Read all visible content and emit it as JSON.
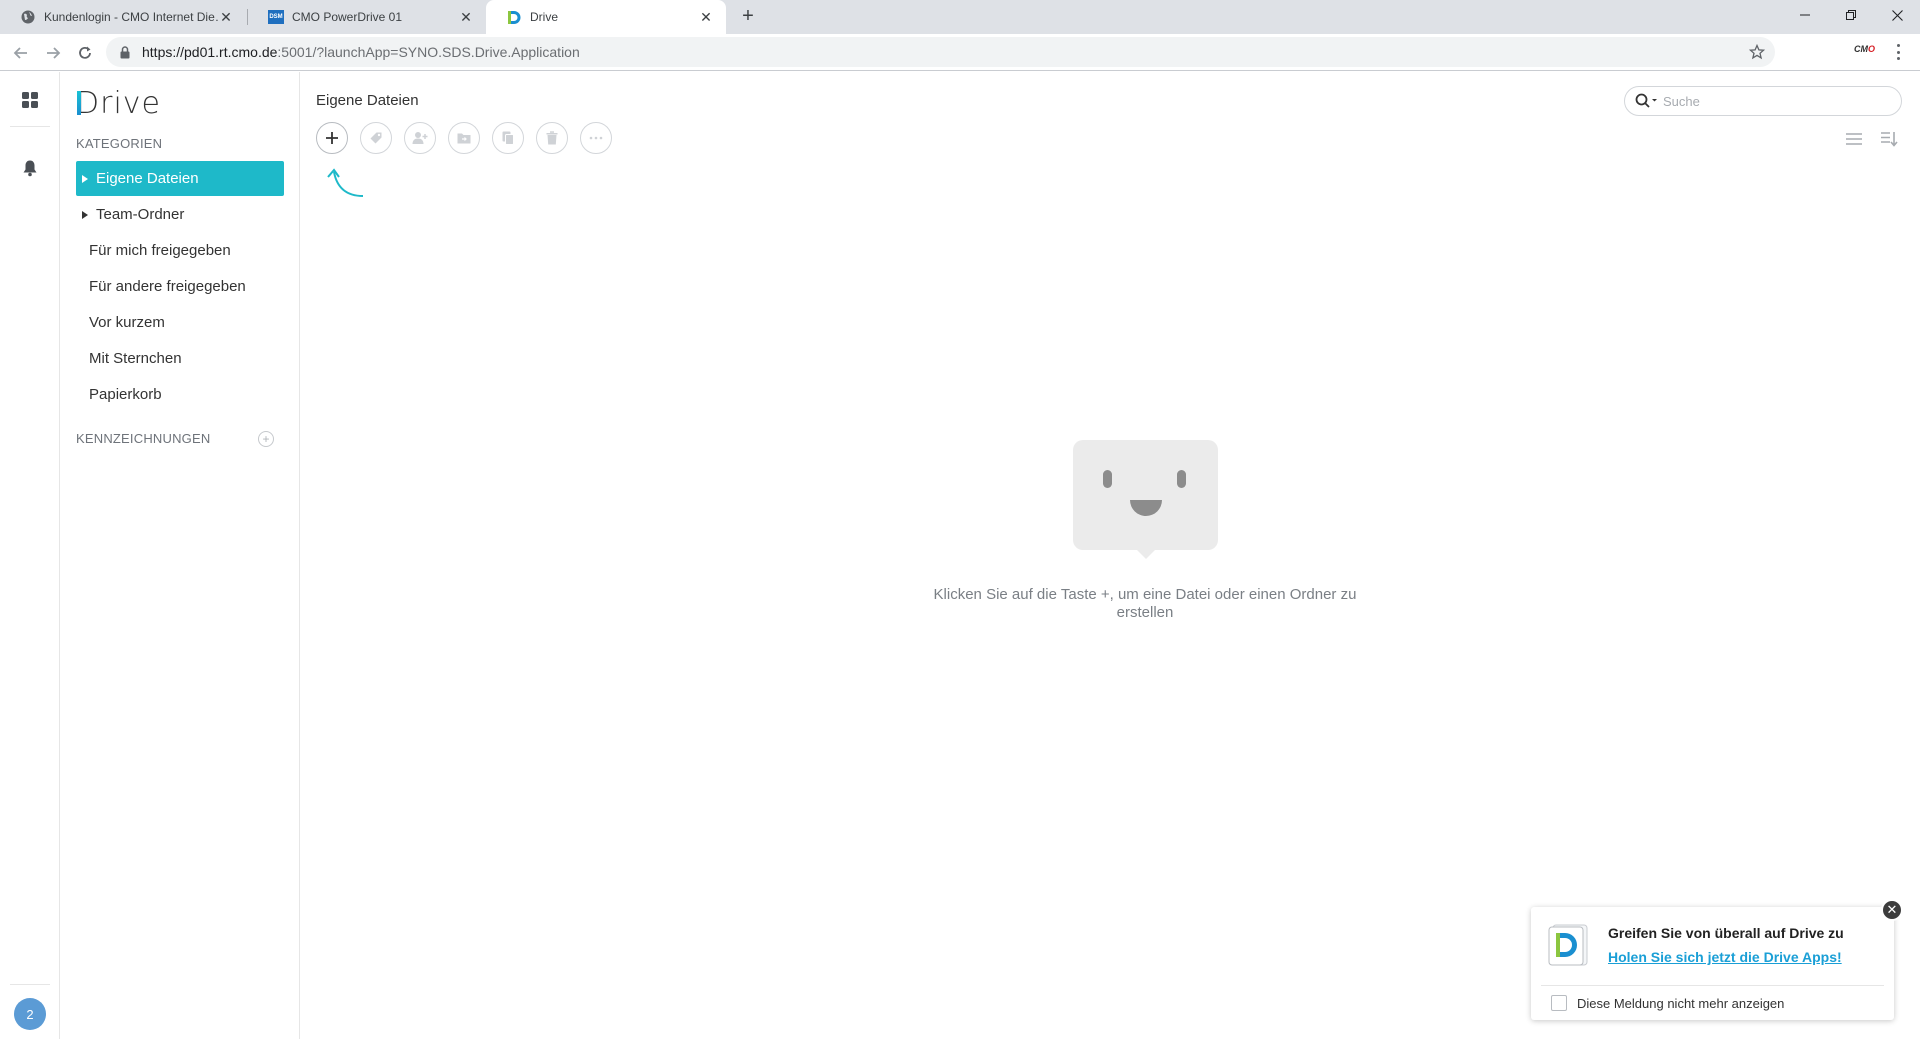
{
  "browser": {
    "tabs": [
      {
        "title": "Kundenlogin - CMO Internet Die…",
        "favicon": "globe-icon",
        "active": false
      },
      {
        "title": "CMO PowerDrive 01",
        "favicon": "dsm-icon",
        "active": false
      },
      {
        "title": "Drive",
        "favicon": "drive-icon",
        "active": true
      }
    ],
    "favicon_dsm_text": "DSM",
    "url_host": "https://pd01.rt.cmo.de",
    "url_rest": ":5001/?launchApp=SYNO.SDS.Drive.Application",
    "extension_label_black": "CM",
    "extension_label_red": "O"
  },
  "rail": {
    "avatar_text": "2"
  },
  "sidebar": {
    "logo_rest": "rive",
    "logo_letter": "D",
    "categories_label": "KATEGORIEN",
    "items": [
      {
        "label": "Eigene Dateien",
        "active": true,
        "expandable": true
      },
      {
        "label": "Team-Ordner",
        "active": false,
        "expandable": true
      },
      {
        "label": "Für mich freigegeben",
        "active": false,
        "expandable": false
      },
      {
        "label": "Für andere freigegeben",
        "active": false,
        "expandable": false
      },
      {
        "label": "Vor kurzem",
        "active": false,
        "expandable": false
      },
      {
        "label": "Mit Sternchen",
        "active": false,
        "expandable": false
      },
      {
        "label": "Papierkorb",
        "active": false,
        "expandable": false
      }
    ],
    "tags_label": "KENNZEICHNUNGEN"
  },
  "main": {
    "title": "Eigene Dateien",
    "search_placeholder": "Suche",
    "empty_message": "Klicken Sie auf die Taste +, um eine Datei oder einen Ordner zu erstellen"
  },
  "notification": {
    "title": "Greifen Sie von überall auf Drive zu",
    "link": "Holen Sie sich jetzt die Drive Apps!",
    "checkbox_label": "Diese Meldung nicht mehr anzeigen"
  },
  "colors": {
    "accent": "#1eb9c9",
    "link": "#1a9fd6"
  }
}
